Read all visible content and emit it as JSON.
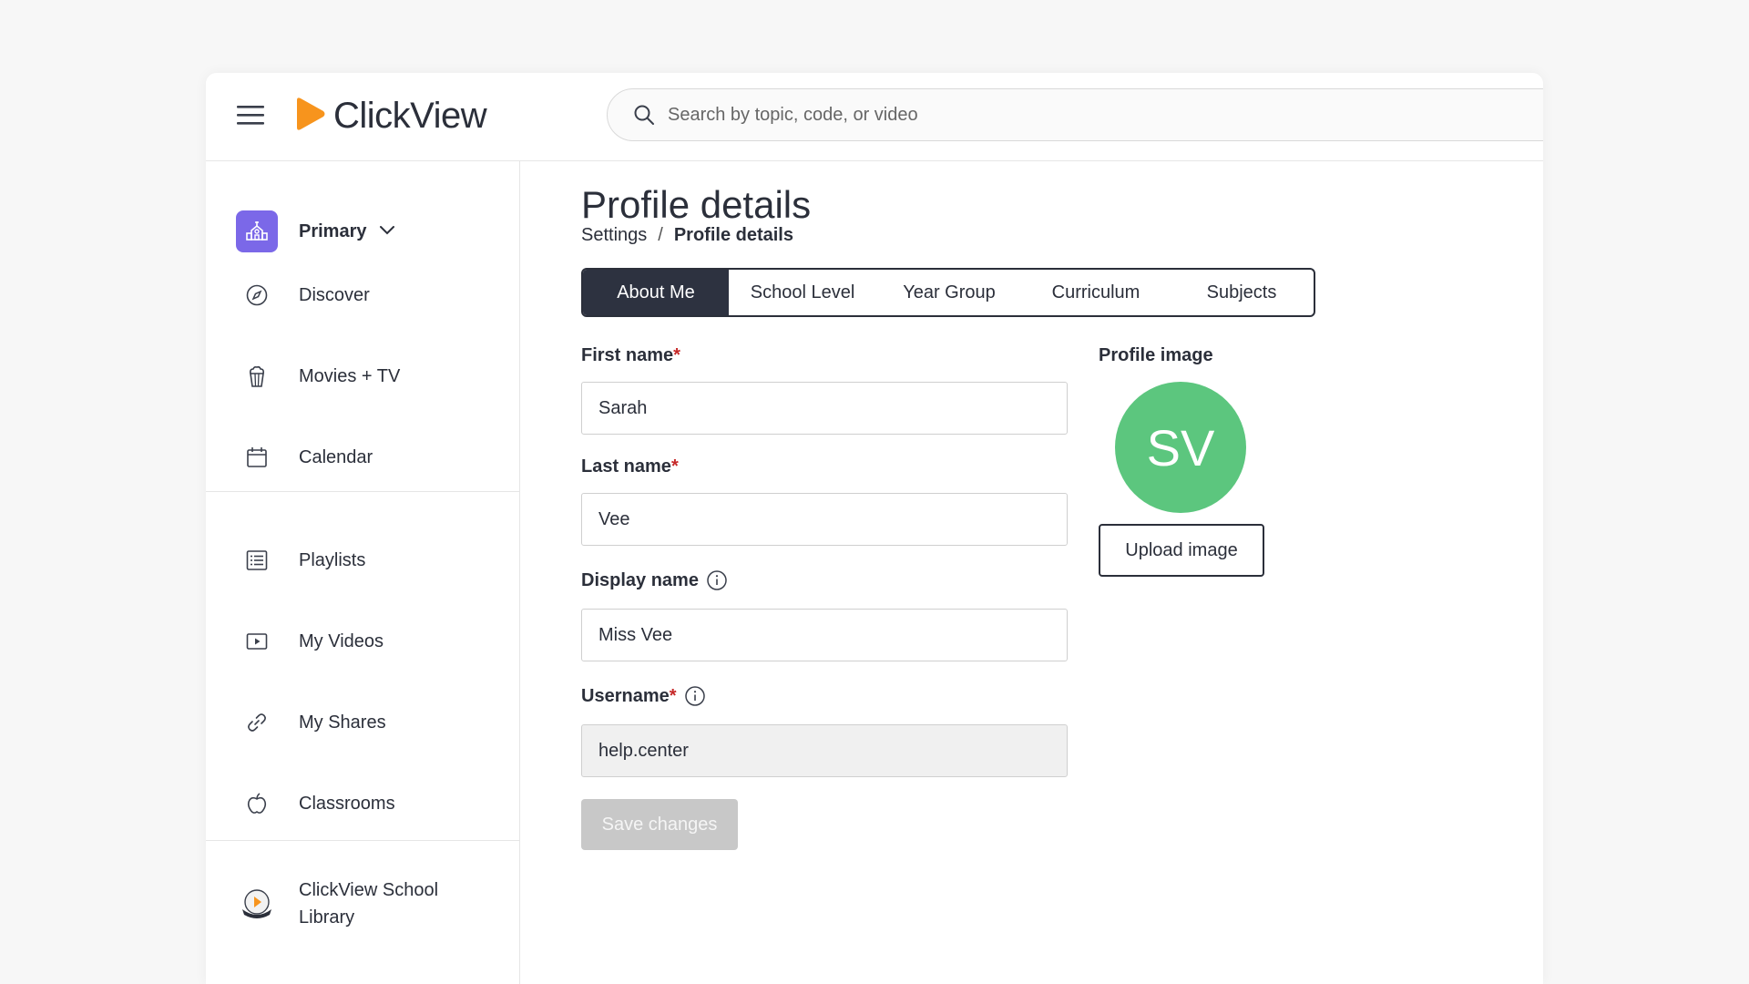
{
  "brand": {
    "name": "ClickView",
    "accent_color": "#f7941d"
  },
  "search": {
    "placeholder": "Search by topic, code, or video"
  },
  "sidebar": {
    "school_selector": {
      "label": "Primary",
      "icon": "school-icon"
    },
    "items": [
      {
        "label": "Discover",
        "icon": "compass-icon"
      },
      {
        "label": "Movies + TV",
        "icon": "popcorn-icon"
      },
      {
        "label": "Calendar",
        "icon": "calendar-icon"
      },
      {
        "label": "Playlists",
        "icon": "list-icon"
      },
      {
        "label": "My Videos",
        "icon": "video-icon"
      },
      {
        "label": "My Shares",
        "icon": "link-icon"
      },
      {
        "label": "Classrooms",
        "icon": "apple-icon"
      },
      {
        "label": "ClickView School Library",
        "icon": "library-badge-icon"
      }
    ]
  },
  "main": {
    "title": "Profile details",
    "breadcrumb": {
      "parent": "Settings",
      "separator": "/",
      "current": "Profile details"
    },
    "tabs": [
      "About Me",
      "School Level",
      "Year Group",
      "Curriculum",
      "Subjects"
    ],
    "active_tab": "About Me",
    "form": {
      "first_name": {
        "label": "First name",
        "required": "*",
        "value": "Sarah"
      },
      "last_name": {
        "label": "Last name",
        "required": "*",
        "value": "Vee"
      },
      "display_name": {
        "label": "Display name",
        "value": "Miss Vee"
      },
      "username": {
        "label": "Username",
        "required": "*",
        "value": "help.center"
      },
      "save_label": "Save changes"
    },
    "profile_image": {
      "label": "Profile image",
      "initials": "SV",
      "avatar_color": "#5cc67e",
      "upload_label": "Upload image"
    }
  }
}
